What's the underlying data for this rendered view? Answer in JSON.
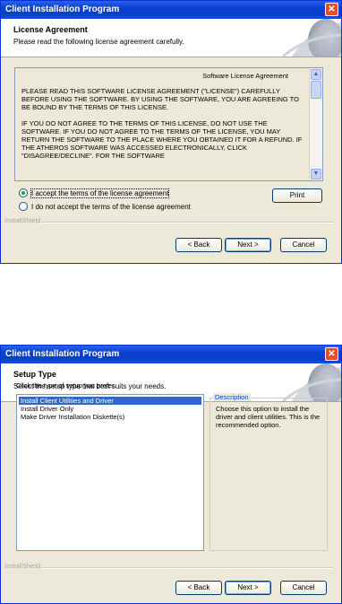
{
  "window1": {
    "title": "Client Installation Program",
    "header_title": "License Agreement",
    "header_subtitle": "Please read the following license agreement carefully.",
    "license": {
      "heading": "Software License Agreement",
      "paragraph1": "PLEASE READ THIS SOFTWARE LICENSE AGREEMENT (\"LICENSE\") CAREFULLY BEFORE USING THE SOFTWARE. BY USING THE SOFTWARE, YOU ARE AGREEING TO BE BOUND BY THE TERMS OF THIS LICENSE.",
      "paragraph2": "IF YOU DO NOT AGREE TO THE TERMS OF THIS LICENSE, DO NOT USE THE SOFTWARE. IF YOU DO NOT AGREE TO THE TERMS OF THE LICENSE, YOU MAY RETURN THE SOFTWARE TO THE PLACE WHERE YOU OBTAINED IT FOR A REFUND. IF THE ATHEROS SOFTWARE WAS ACCESSED ELECTRONICALLY, CLICK \"DISAGREE/DECLINE\". FOR THE SOFTWARE"
    },
    "radio_accept": "I accept the terms of the license agreement",
    "radio_decline": "I do not accept the terms of the license agreement",
    "print_label": "Print",
    "installshield": "InstallShield",
    "back_label": "< Back",
    "next_label": "Next >",
    "cancel_label": "Cancel"
  },
  "window2": {
    "title": "Client Installation Program",
    "header_title": "Setup Type",
    "header_subtitle": "Select the setup type that best suits your needs.",
    "prompt": "Click the type of setup you prefer.",
    "options": [
      "Install Client Utilities and Driver",
      "Install Driver Only",
      "Make Driver Installation Diskette(s)"
    ],
    "description_label": "Description",
    "description_text": "Choose this option to install the driver and client utilities. This is the recommended option.",
    "installshield": "InstallShield",
    "back_label": "< Back",
    "next_label": "Next >",
    "cancel_label": "Cancel"
  },
  "icons": {
    "close": "close-icon",
    "scroll_up": "scroll-up-arrow-icon",
    "scroll_down": "scroll-down-arrow-icon",
    "logo": "wireless-logo-graphic"
  }
}
